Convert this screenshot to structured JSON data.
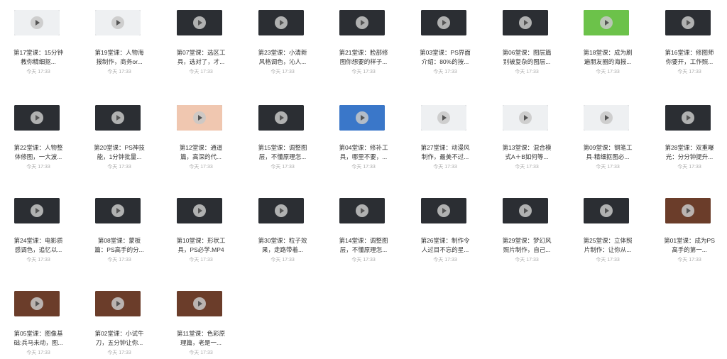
{
  "files": [
    {
      "name": "第17堂课：15分钟教你精细抠...",
      "time": "今天 17:33",
      "theme": "light"
    },
    {
      "name": "第19堂课：人物海报制作，商务or...",
      "time": "今天 17:33",
      "theme": "light"
    },
    {
      "name": "第07堂课：选区工具，选对了，才...",
      "time": "今天 17:33",
      "theme": "dark"
    },
    {
      "name": "第23堂课：小清新风格调色，沁人...",
      "time": "今天 17:33",
      "theme": "dark"
    },
    {
      "name": "第21堂课：脸部修图你想要的样子...",
      "time": "今天 17:33",
      "theme": "dark"
    },
    {
      "name": "第03堂课：PS界面介绍：80%的按...",
      "time": "今天 17:33",
      "theme": "dark"
    },
    {
      "name": "第06堂课：图层篇别被复杂的图层...",
      "time": "今天 17:33",
      "theme": "dark"
    },
    {
      "name": "第18堂课：成为刷遍朋友圈的海报...",
      "time": "今天 17:33",
      "theme": "green"
    },
    {
      "name": "第16堂课：修图师你要开，工作照...",
      "time": "今天 17:33",
      "theme": "dark"
    },
    {
      "name": "第22堂课：人物整体修图，一大波...",
      "time": "今天 17:33",
      "theme": "dark"
    },
    {
      "name": "第20堂课：PS神技能，1分钟批量...",
      "time": "今天 17:33",
      "theme": "dark"
    },
    {
      "name": "第12堂课：通道篇，高深的代...",
      "time": "今天 17:33",
      "theme": "peach"
    },
    {
      "name": "第15堂课：调整图层，不懂原理怎...",
      "time": "今天 17:33",
      "theme": "dark"
    },
    {
      "name": "第04堂课：修补工具，哪里不要，...",
      "time": "今天 17:33",
      "theme": "blue"
    },
    {
      "name": "第27堂课：动漫风制作，最美不过...",
      "time": "今天 17:33",
      "theme": "light"
    },
    {
      "name": "第13堂课：混合模式A＋B如何等...",
      "time": "今天 17:33",
      "theme": "light"
    },
    {
      "name": "第09堂课：钢笔工具-精细抠图必...",
      "time": "今天 17:33",
      "theme": "light"
    },
    {
      "name": "第28堂课：双重曝光：分分钟提升...",
      "time": "今天 17:33",
      "theme": "dark"
    },
    {
      "name": "第24堂课：电影质感调色，追忆以...",
      "time": "今天 17:33",
      "theme": "dark"
    },
    {
      "name": "第08堂课：蒙板篇：PS高手的分...",
      "time": "今天 17:33",
      "theme": "dark"
    },
    {
      "name": "第10堂课：形状工具，PS必学.MP4",
      "time": "今天 17:33",
      "theme": "dark"
    },
    {
      "name": "第30堂课：粒子效果，走路带着...",
      "time": "今天 17:33",
      "theme": "dark"
    },
    {
      "name": "第14堂课：调整图层，不懂原理怎...",
      "time": "今天 17:33",
      "theme": "dark"
    },
    {
      "name": "第26堂课：制作令人过目不忘的星...",
      "time": "今天 17:33",
      "theme": "dark"
    },
    {
      "name": "第29堂课：梦幻风照片制作，自己...",
      "time": "今天 17:33",
      "theme": "dark"
    },
    {
      "name": "第25堂课：立体照片制作：让你从...",
      "time": "今天 17:33",
      "theme": "dark"
    },
    {
      "name": "第01堂课：成为PS高手的第一...",
      "time": "今天 17:33",
      "theme": "brown"
    },
    {
      "name": "第05堂课：图像基础:兵马未动，图...",
      "time": "今天 17:33",
      "theme": "brown"
    },
    {
      "name": "第02堂课：小试牛刀，五分钟让你...",
      "time": "今天 17:33",
      "theme": "brown"
    },
    {
      "name": "第11堂课：色彩原理篇，老是一...",
      "time": "今天 17:33",
      "theme": "brown"
    }
  ],
  "colors": {
    "light": "#eef0f2",
    "dark": "#2b2e33",
    "green": "#6cc24a",
    "peach": "#f0c7b0",
    "blue": "#3a77c9",
    "brown": "#6b3d2a"
  }
}
